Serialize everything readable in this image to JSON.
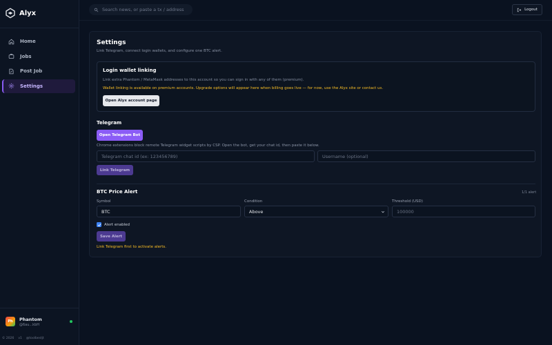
{
  "brand": {
    "name": "Alyx"
  },
  "search": {
    "placeholder": "Search news, or paste a tx / address"
  },
  "header": {
    "logout_label": "Logout"
  },
  "sidebar": {
    "items": [
      {
        "label": "Home",
        "icon": "home-icon",
        "active": false
      },
      {
        "label": "Jobs",
        "icon": "briefcase-icon",
        "active": false
      },
      {
        "label": "Post Job",
        "icon": "document-edit-icon",
        "active": false
      },
      {
        "label": "Settings",
        "icon": "gear-icon",
        "active": true
      }
    ],
    "user": {
      "initials": "Ph",
      "name": "Phantom",
      "handle": "@6au...kbH",
      "status": "online"
    },
    "footer": {
      "copyright": "© 2026",
      "version": "v1",
      "handle": "@toolbestjt"
    }
  },
  "settings": {
    "title": "Settings",
    "subtitle": "Link Telegram, connect login wallets, and configure one BTC alert.",
    "wallet": {
      "title": "Login wallet linking",
      "description": "Link extra Phantom / MetaMask addresses to this account so you can sign in with any of them (premium).",
      "warning": "Wallet linking is available on premium accounts. Upgrade options will appear here when billing goes live — for now, use the Alyx site or contact us.",
      "button_label": "Open Alyx account page"
    },
    "telegram": {
      "title": "Telegram",
      "open_bot_label": "Open Telegram Bot",
      "hint": "Chrome extensions block remote Telegram widget scripts by CSP. Open the bot, get your chat id, then paste it below.",
      "chat_id_placeholder": "Telegram chat id (ex: 123456789)",
      "username_placeholder": "Username (optional)",
      "link_label": "Link Telegram"
    },
    "alert": {
      "title": "BTC Price Alert",
      "counter": "1/1 alert",
      "symbol_label": "Symbol",
      "symbol_value": "BTC",
      "condition_label": "Condition",
      "condition_value": "Above",
      "threshold_label": "Threshold (USD)",
      "threshold_placeholder": "100000",
      "enabled_label": "Alert enabled",
      "enabled": true,
      "save_label": "Save Alert",
      "note": "Link Telegram first to activate alerts."
    }
  },
  "colors": {
    "accent": "#8b5cf6",
    "warning": "#fbbf24",
    "online": "#22c55e",
    "background": "#0a1220"
  }
}
